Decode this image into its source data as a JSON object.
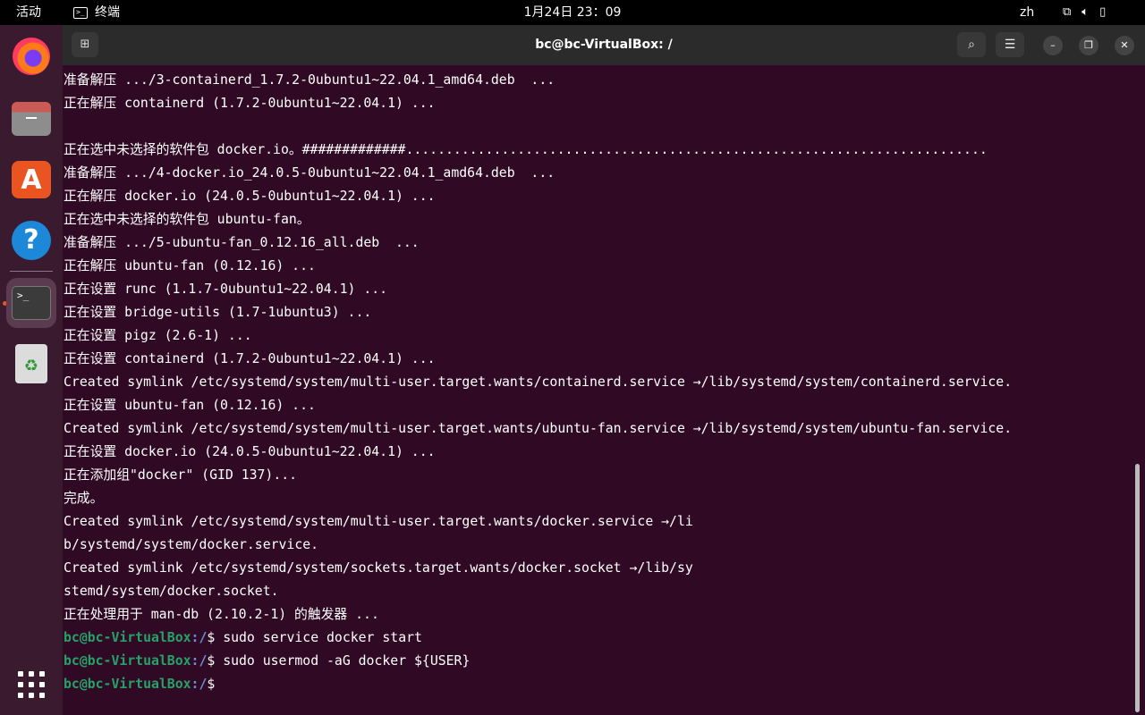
{
  "topbar": {
    "activities": "活动",
    "app_name": "终端",
    "clock": "1月24日  23：09",
    "lang": "zh"
  },
  "dock": {
    "apps": [
      "firefox-icon",
      "files-icon",
      "app-center-icon",
      "help-icon",
      "terminal-icon",
      "trash-icon",
      "show-apps-icon"
    ]
  },
  "window": {
    "title": "bc@bc-VirtualBox: /"
  },
  "terminal": {
    "prompt_user": "bc@bc-VirtualBox",
    "prompt_path": ":/",
    "prompt_symbol": "$ ",
    "lines": [
      "准备解压 .../3-containerd_1.7.2-0ubuntu1~22.04.1_amd64.deb  ...",
      "正在解压 containerd (1.7.2-0ubuntu1~22.04.1) ...",
      "",
      "正在选中未选择的软件包 docker.io。#############.........................................................................",
      "准备解压 .../4-docker.io_24.0.5-0ubuntu1~22.04.1_amd64.deb  ...",
      "正在解压 docker.io (24.0.5-0ubuntu1~22.04.1) ...",
      "正在选中未选择的软件包 ubuntu-fan。",
      "准备解压 .../5-ubuntu-fan_0.12.16_all.deb  ...",
      "正在解压 ubuntu-fan (0.12.16) ...",
      "正在设置 runc (1.1.7-0ubuntu1~22.04.1) ...",
      "正在设置 bridge-utils (1.7-1ubuntu3) ...",
      "正在设置 pigz (2.6-1) ...",
      "正在设置 containerd (1.7.2-0ubuntu1~22.04.1) ...",
      "Created symlink /etc/systemd/system/multi-user.target.wants/containerd.service →/lib/systemd/system/containerd.service.",
      "正在设置 ubuntu-fan (0.12.16) ...",
      "Created symlink /etc/systemd/system/multi-user.target.wants/ubuntu-fan.service →/lib/systemd/system/ubuntu-fan.service.",
      "正在设置 docker.io (24.0.5-0ubuntu1~22.04.1) ...",
      "正在添加组\"docker\" (GID 137)...",
      "完成。",
      "Created symlink /etc/systemd/system/multi-user.target.wants/docker.service →/li",
      "b/systemd/system/docker.service.",
      "Created symlink /etc/systemd/system/sockets.target.wants/docker.socket →/lib/sy",
      "stemd/system/docker.socket.",
      "正在处理用于 man-db (2.10.2-1) 的触发器 ..."
    ],
    "commands": [
      "sudo service docker start",
      "sudo usermod -aG docker ${USER}",
      ""
    ]
  }
}
